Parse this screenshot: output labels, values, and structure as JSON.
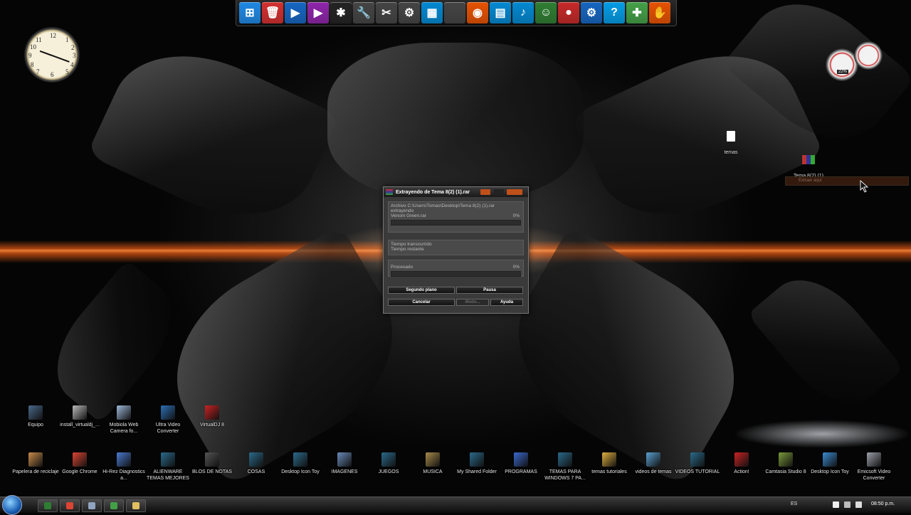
{
  "dock": {
    "items": [
      {
        "name": "windows-icon",
        "color": "#1e88e5",
        "glyph": "⊞"
      },
      {
        "name": "trash-icon",
        "color": "#d32f2f",
        "glyph": "🗑"
      },
      {
        "name": "video-camera-icon",
        "color": "#1565c0",
        "glyph": "▶"
      },
      {
        "name": "media-player-icon",
        "color": "#8e24aa",
        "glyph": "▶"
      },
      {
        "name": "network-icon",
        "color": "#222222",
        "glyph": "✱"
      },
      {
        "name": "wrench-icon",
        "color": "#444444",
        "glyph": "🔧"
      },
      {
        "name": "tools-icon",
        "color": "#444444",
        "glyph": "✂"
      },
      {
        "name": "gear-icon",
        "color": "#444444",
        "glyph": "⚙"
      },
      {
        "name": "film-icon",
        "color": "#0288d1",
        "glyph": "▦"
      },
      {
        "name": "apple-icon",
        "color": "#444444",
        "glyph": ""
      },
      {
        "name": "ubuntu-icon",
        "color": "#e65100",
        "glyph": "◉"
      },
      {
        "name": "document-icon",
        "color": "#0288d1",
        "glyph": "▤"
      },
      {
        "name": "music-icon",
        "color": "#0288d1",
        "glyph": "♪"
      },
      {
        "name": "user-icon",
        "color": "#2e7d32",
        "glyph": "☺"
      },
      {
        "name": "record-icon",
        "color": "#c62828",
        "glyph": "●"
      },
      {
        "name": "settings-icon",
        "color": "#1565c0",
        "glyph": "⚙"
      },
      {
        "name": "help-icon",
        "color": "#039be5",
        "glyph": "?"
      },
      {
        "name": "gamepad-icon",
        "color": "#43a047",
        "glyph": "✚"
      },
      {
        "name": "hand-icon",
        "color": "#e65100",
        "glyph": "✋"
      }
    ]
  },
  "meter": {
    "cpu_text": "22%"
  },
  "right_icons": [
    {
      "label": "temas"
    },
    {
      "label": "Tema 8(2) (1)"
    }
  ],
  "context_menu": {
    "item": "Extraer aquí"
  },
  "dialog": {
    "title": "Extrayendo de Tema 8(2) (1).rar",
    "archive_line": "Archivo C:\\Users\\Tomas\\Desktop\\Tema 8(2) (1).rar",
    "status": "extrayendo",
    "current_file": "Venom Green.rar",
    "current_percent": "0%",
    "elapsed_label": "Tiempo transcurrido",
    "remaining_label": "Tiempo restante",
    "processed_label": "Procesado",
    "processed_percent": "0%",
    "buttons": {
      "background": "Segundo plano",
      "pause": "Pausa",
      "cancel": "Cancelar",
      "mode": "Modo...",
      "help": "Ayuda"
    }
  },
  "desktop_row1": [
    {
      "label": "Equipo",
      "color": "#4a6a8a"
    },
    {
      "label": "install_virtualdj_...",
      "color": "#bbbbbb"
    },
    {
      "label": "Mobiola Web Camera fo...",
      "color": "#9fb9d9"
    },
    {
      "label": "Ultra Video Converter",
      "color": "#2d6fb6"
    },
    {
      "label": "VirtualDJ 8",
      "color": "#cc2222"
    }
  ],
  "desktop_row2": [
    {
      "label": "Papelera de reciclaje",
      "color": "#c98a4a"
    },
    {
      "label": "Google Chrome",
      "color": "#dd4433"
    },
    {
      "label": "Hi-Rez Diagnostics a...",
      "color": "#4a7ad0"
    },
    {
      "label": "ALIENWARE TEMAS MEJORES",
      "color": "#2a6a8a"
    },
    {
      "label": "BLOS DE NOTAS",
      "color": "#555555"
    },
    {
      "label": "COSAS",
      "color": "#2a6a8a"
    },
    {
      "label": "Desktop Icon Toy",
      "color": "#2a6a8a"
    },
    {
      "label": "IMAGENES",
      "color": "#6a8aba"
    },
    {
      "label": "JUEGOS",
      "color": "#2a6a8a"
    },
    {
      "label": "MUSICA",
      "color": "#a88a4a"
    },
    {
      "label": "My Shared Folder",
      "color": "#2a6a8a"
    },
    {
      "label": "PROGRAMAS",
      "color": "#3a6ad0"
    },
    {
      "label": "TEMAS PARA WINDOWS 7 PA...",
      "color": "#2a6a8a"
    },
    {
      "label": "temas tutoriales",
      "color": "#e0b040"
    },
    {
      "label": "videos de temas",
      "color": "#5aa0d0"
    },
    {
      "label": "VIDEOS TUTORIAL",
      "color": "#2a6a8a"
    },
    {
      "label": "Action!",
      "color": "#cc2222"
    },
    {
      "label": "Camtasia Studio 8",
      "color": "#7a9a3a"
    },
    {
      "label": "Desktop Icon Toy",
      "color": "#3a8ad0"
    },
    {
      "label": "Emicsoft Video Converter",
      "color": "#9aa0aa"
    }
  ],
  "taskbar": {
    "language": "ES",
    "time": "08:50 p.m.",
    "buttons": [
      {
        "name": "excel-taskbar-icon",
        "color": "#2e7d32"
      },
      {
        "name": "chrome-taskbar-icon",
        "color": "#dd4433"
      },
      {
        "name": "explorer-taskbar-icon",
        "color": "#90a4c0"
      },
      {
        "name": "camtasia-taskbar-icon",
        "color": "#43a047"
      },
      {
        "name": "folder-taskbar-icon",
        "color": "#e0c060"
      }
    ]
  }
}
